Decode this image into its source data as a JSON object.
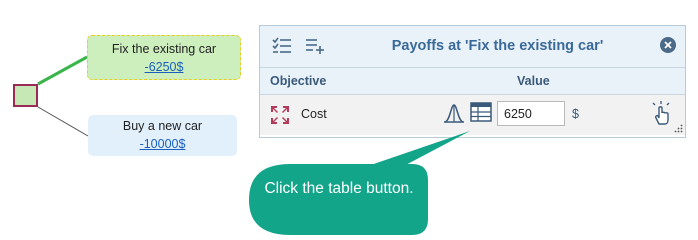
{
  "tree": {
    "options": [
      {
        "title": "Fix  the existing car",
        "value": "-6250$"
      },
      {
        "title": "Buy a new car",
        "value": "-10000$"
      }
    ]
  },
  "panel": {
    "title": "Payoffs at 'Fix  the existing car'",
    "columns": {
      "objective": "Objective",
      "value": "Value"
    },
    "rows": [
      {
        "objective": "Cost",
        "value": "6250",
        "unit": "$"
      }
    ]
  },
  "callout": {
    "text": "Click the table button."
  },
  "colors": {
    "selected_option_bg": "#cdeebd",
    "option_bg": "#e2f0fb",
    "panel_title": "#3a6a99",
    "callout_bg": "#12a58a",
    "decision_node_border": "#9b2b55"
  },
  "icons": {
    "header": [
      "checklist-icon",
      "add-list-icon"
    ],
    "close": "close-icon",
    "row": [
      "cost-icon",
      "distribution-icon",
      "table-icon",
      "hand-pointer-icon"
    ]
  }
}
